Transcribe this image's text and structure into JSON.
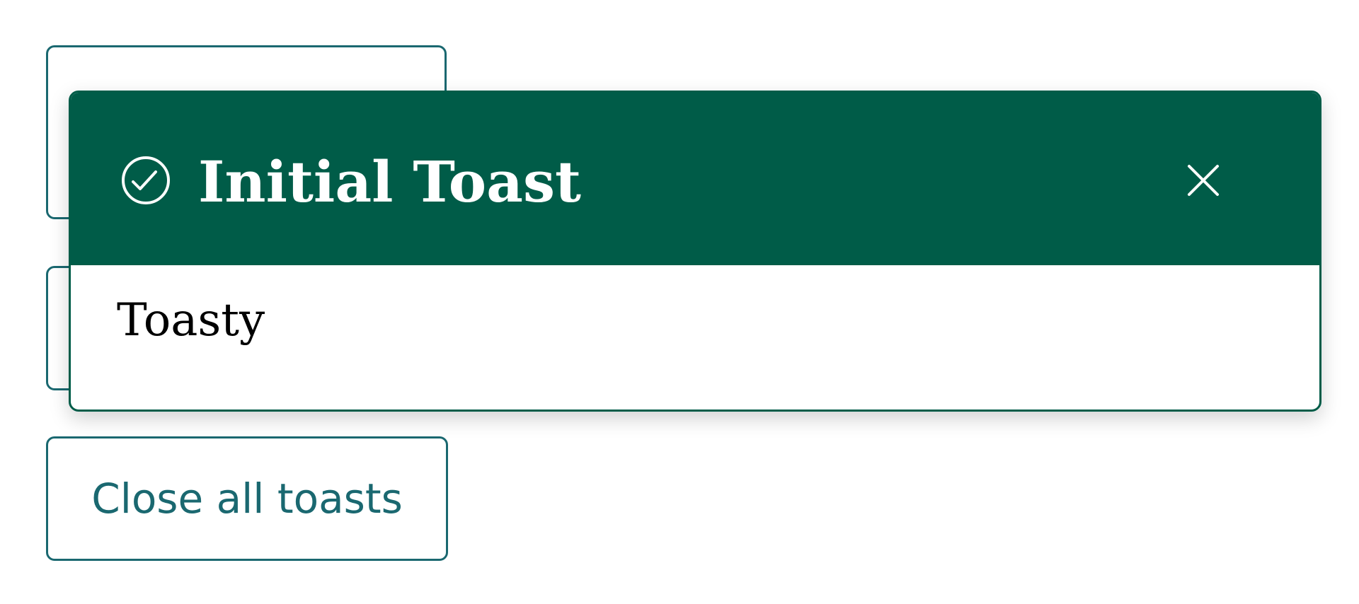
{
  "buttons": {
    "close_all_label": "Close all toasts"
  },
  "toast": {
    "title": "Initial Toast",
    "body": "Toasty",
    "status_icon": "check-circle-icon",
    "close_icon": "close-icon",
    "header_color": "#005c48"
  },
  "colors": {
    "accent": "#1a6870",
    "toast_green": "#005c48",
    "background": "#ffffff"
  }
}
